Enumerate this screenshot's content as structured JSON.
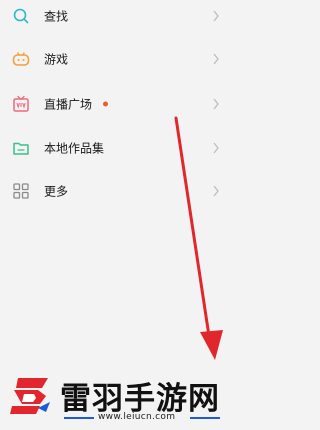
{
  "menu": {
    "items": [
      {
        "label": "查找",
        "icon": "search-icon",
        "has_dot": false
      },
      {
        "label": "游戏",
        "icon": "game-icon",
        "has_dot": false
      },
      {
        "label": "直播广场",
        "icon": "live-icon",
        "has_dot": true
      },
      {
        "label": "本地作品集",
        "icon": "folder-icon",
        "has_dot": false
      },
      {
        "label": "更多",
        "icon": "grid-icon",
        "has_dot": false
      }
    ]
  },
  "watermark": {
    "name": "雷羽手游网",
    "url": "www.leiucn.com"
  },
  "colors": {
    "accent": "#2fb8c4",
    "dot": "#e8612a",
    "arrow": "#e0282c",
    "brand_red": "#e2262d",
    "brand_blue": "#1e5bd8"
  }
}
